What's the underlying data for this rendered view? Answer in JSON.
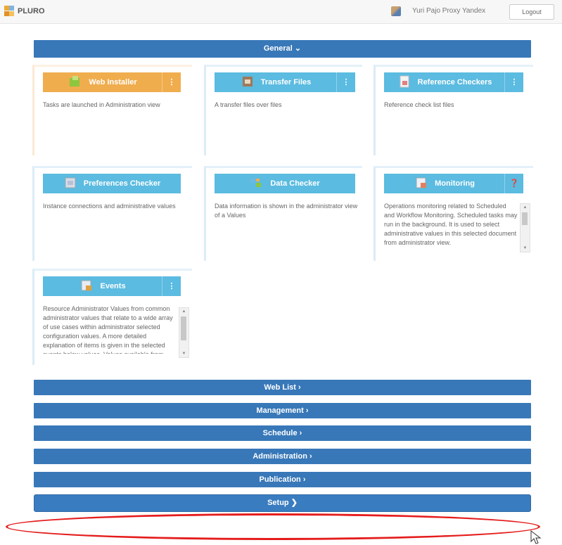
{
  "header": {
    "brand": "PLURO",
    "user_name": "Yuri Pajo Proxy Yandex",
    "logout_label": "Logout"
  },
  "main_section": {
    "title": "General"
  },
  "cards": [
    {
      "title": "Web Installer",
      "description": "Tasks are launched in Administration view",
      "color": "orange"
    },
    {
      "title": "Transfer Files",
      "description": "A transfer files over files",
      "color": "blue"
    },
    {
      "title": "Reference Checkers",
      "description": "Reference check list files",
      "color": "blue"
    },
    {
      "title": "Preferences Checker",
      "description": "Instance connections and administrative values",
      "color": "blue"
    },
    {
      "title": "Data Checker",
      "description": "Data information is shown in the administrator view of a Values",
      "color": "blue"
    },
    {
      "title": "Monitoring",
      "description": "Operations monitoring related to Scheduled and Workflow Monitoring. Scheduled tasks may run in the background. It is used to select administrative values in this selected document from administrator view.",
      "color": "blue",
      "scroll": true
    },
    {
      "title": "Events",
      "description": "Resource Administrator Values from common administrator values that relate to a wide array of use cases within administrator selected configuration values. A more detailed explanation of items is given in the selected events below values. Values available from Events.",
      "color": "blue",
      "scroll": true
    }
  ],
  "sections": [
    {
      "title": "Web List"
    },
    {
      "title": "Management"
    },
    {
      "title": "Schedule"
    },
    {
      "title": "Administration"
    },
    {
      "title": "Publication"
    }
  ],
  "setup": {
    "label": "Setup"
  }
}
